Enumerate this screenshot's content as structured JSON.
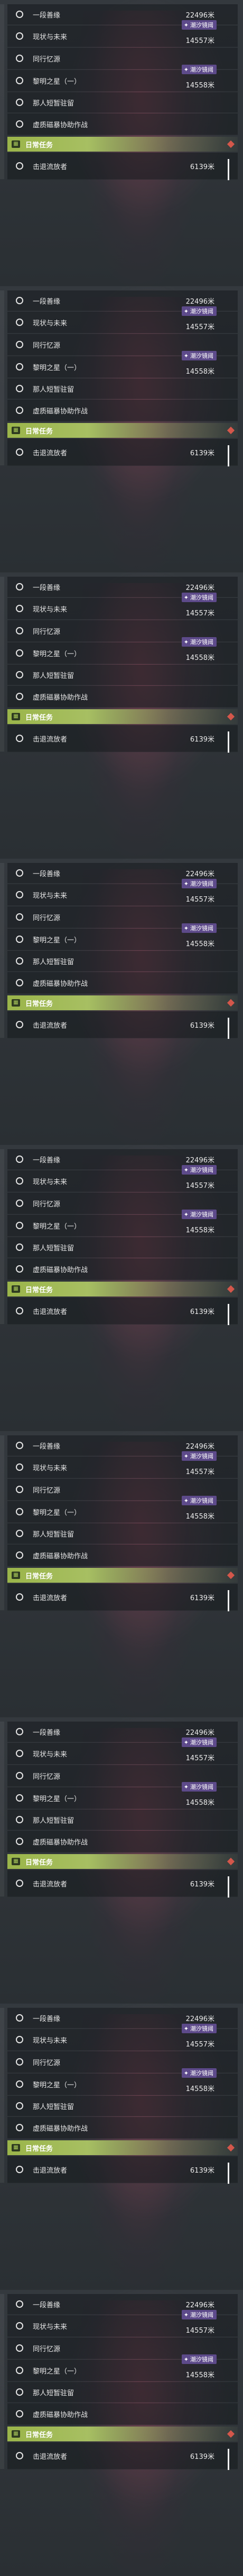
{
  "quests": [
    {
      "name": "一段善缘",
      "distance": "22496米"
    },
    {
      "name": "现状与未来",
      "distance": "14557米",
      "tag": "潮汐镜阈"
    },
    {
      "name": "同行忆源",
      "distance": ""
    },
    {
      "name": "黎明之星（一）",
      "distance": "14558米",
      "tag": "潮汐镜阈"
    },
    {
      "name": "那人短暂驻留",
      "distance": ""
    },
    {
      "name": "虚质磁暴协助作战",
      "distance": ""
    }
  ],
  "daily": {
    "label": "日常任务",
    "icon": "calendar-icon"
  },
  "daily_quest": {
    "name": "击退流放者",
    "distance": "6139米"
  },
  "colors": {
    "daily": "#9bb54a",
    "tag": "#5d4a8a",
    "flag": "#d4574b"
  }
}
